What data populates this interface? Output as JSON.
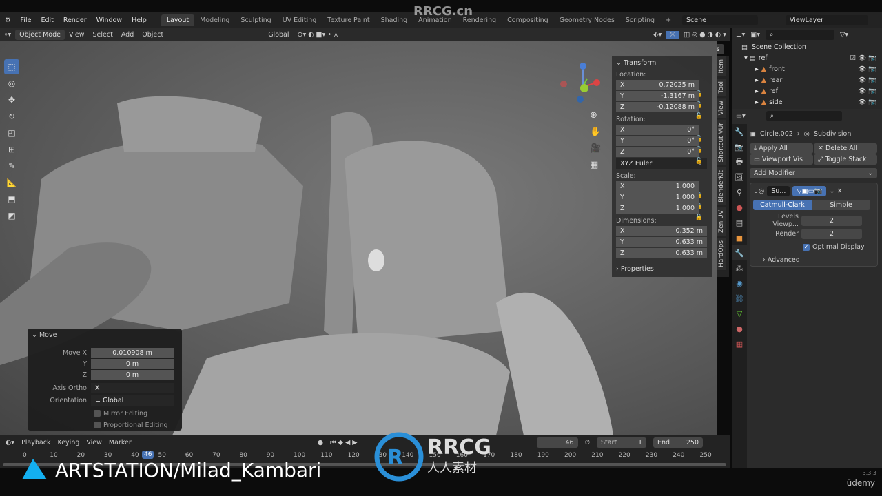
{
  "menu": [
    "File",
    "Edit",
    "Render",
    "Window",
    "Help"
  ],
  "workspaces": [
    "Layout",
    "Modeling",
    "Sculpting",
    "UV Editing",
    "Texture Paint",
    "Shading",
    "Animation",
    "Rendering",
    "Compositing",
    "Geometry Nodes",
    "Scripting",
    "+"
  ],
  "scene": "Scene",
  "view_layer": "ViewLayer",
  "header": {
    "mode": "Object Mode",
    "menus": [
      "View",
      "Select",
      "Add",
      "Object"
    ],
    "orientation": "Global",
    "options": "Options"
  },
  "npanel": {
    "title": "Transform",
    "location_label": "Location:",
    "location": [
      [
        "X",
        "0.72025 m"
      ],
      [
        "Y",
        "-1.3167 m"
      ],
      [
        "Z",
        "-0.12088 m"
      ]
    ],
    "rotation_label": "Rotation:",
    "rotation": [
      [
        "X",
        "0°"
      ],
      [
        "Y",
        "0°"
      ],
      [
        "Z",
        "0°"
      ]
    ],
    "rotation_mode": "XYZ Euler",
    "scale_label": "Scale:",
    "scale": [
      [
        "X",
        "1.000"
      ],
      [
        "Y",
        "1.000"
      ],
      [
        "Z",
        "1.000"
      ]
    ],
    "dimensions_label": "Dimensions:",
    "dimensions": [
      [
        "X",
        "0.352 m"
      ],
      [
        "Y",
        "0.633 m"
      ],
      [
        "Z",
        "0.633 m"
      ]
    ],
    "properties": "Properties",
    "tabs": [
      "Item",
      "Tool",
      "View",
      "Shortcut VUr",
      "BlenderKit",
      "Zen UV",
      "HardOps"
    ]
  },
  "outliner": {
    "root": "Scene Collection",
    "collection": "ref",
    "items": [
      "front",
      "rear",
      "ref",
      "side"
    ]
  },
  "properties": {
    "object": "Circle.002",
    "modifier": "Subdivision",
    "apply_all": "Apply All",
    "delete_all": "Delete All",
    "viewport_vis": "Viewport Vis",
    "toggle_stack": "Toggle Stack",
    "add_modifier": "Add Modifier",
    "mod_name": "Su...",
    "catmull": "Catmull-Clark",
    "simple": "Simple",
    "levels_label": "Levels Viewp...",
    "levels": "2",
    "render_label": "Render",
    "render": "2",
    "optimal": "Optimal Display",
    "advanced": "Advanced"
  },
  "move": {
    "title": "Move",
    "move_x_label": "Move X",
    "move_x": "0.010908 m",
    "y_label": "Y",
    "y": "0 m",
    "z_label": "Z",
    "z": "0 m",
    "axis_ortho_label": "Axis Ortho",
    "axis_ortho": "X",
    "orientation_label": "Orientation",
    "orientation": "Global",
    "mirror": "Mirror Editing",
    "proportional": "Proportional Editing"
  },
  "timeline": {
    "menus": [
      "Playback",
      "Keying",
      "View",
      "Marker"
    ],
    "current": "46",
    "start_label": "Start",
    "start": "1",
    "end_label": "End",
    "end": "250",
    "ticks": [
      "0",
      "10",
      "20",
      "30",
      "40",
      "50",
      "60",
      "70",
      "80",
      "90",
      "100",
      "110",
      "120",
      "130",
      "140",
      "150",
      "160",
      "170",
      "180",
      "190",
      "200",
      "210",
      "220",
      "230",
      "240",
      "250"
    ]
  },
  "watermarks": {
    "rrcg_top": "RRCG.cn",
    "artstation": "ARTSTATION/Milad_Kambari",
    "rrcg_logo": "RRCG",
    "rrcg_cn": "人人素材",
    "udemy": "ūdemy",
    "version": "3.3.3"
  },
  "colors": {
    "accent": "#4772b3",
    "header": "#232323",
    "panel": "#2b2b2b"
  }
}
